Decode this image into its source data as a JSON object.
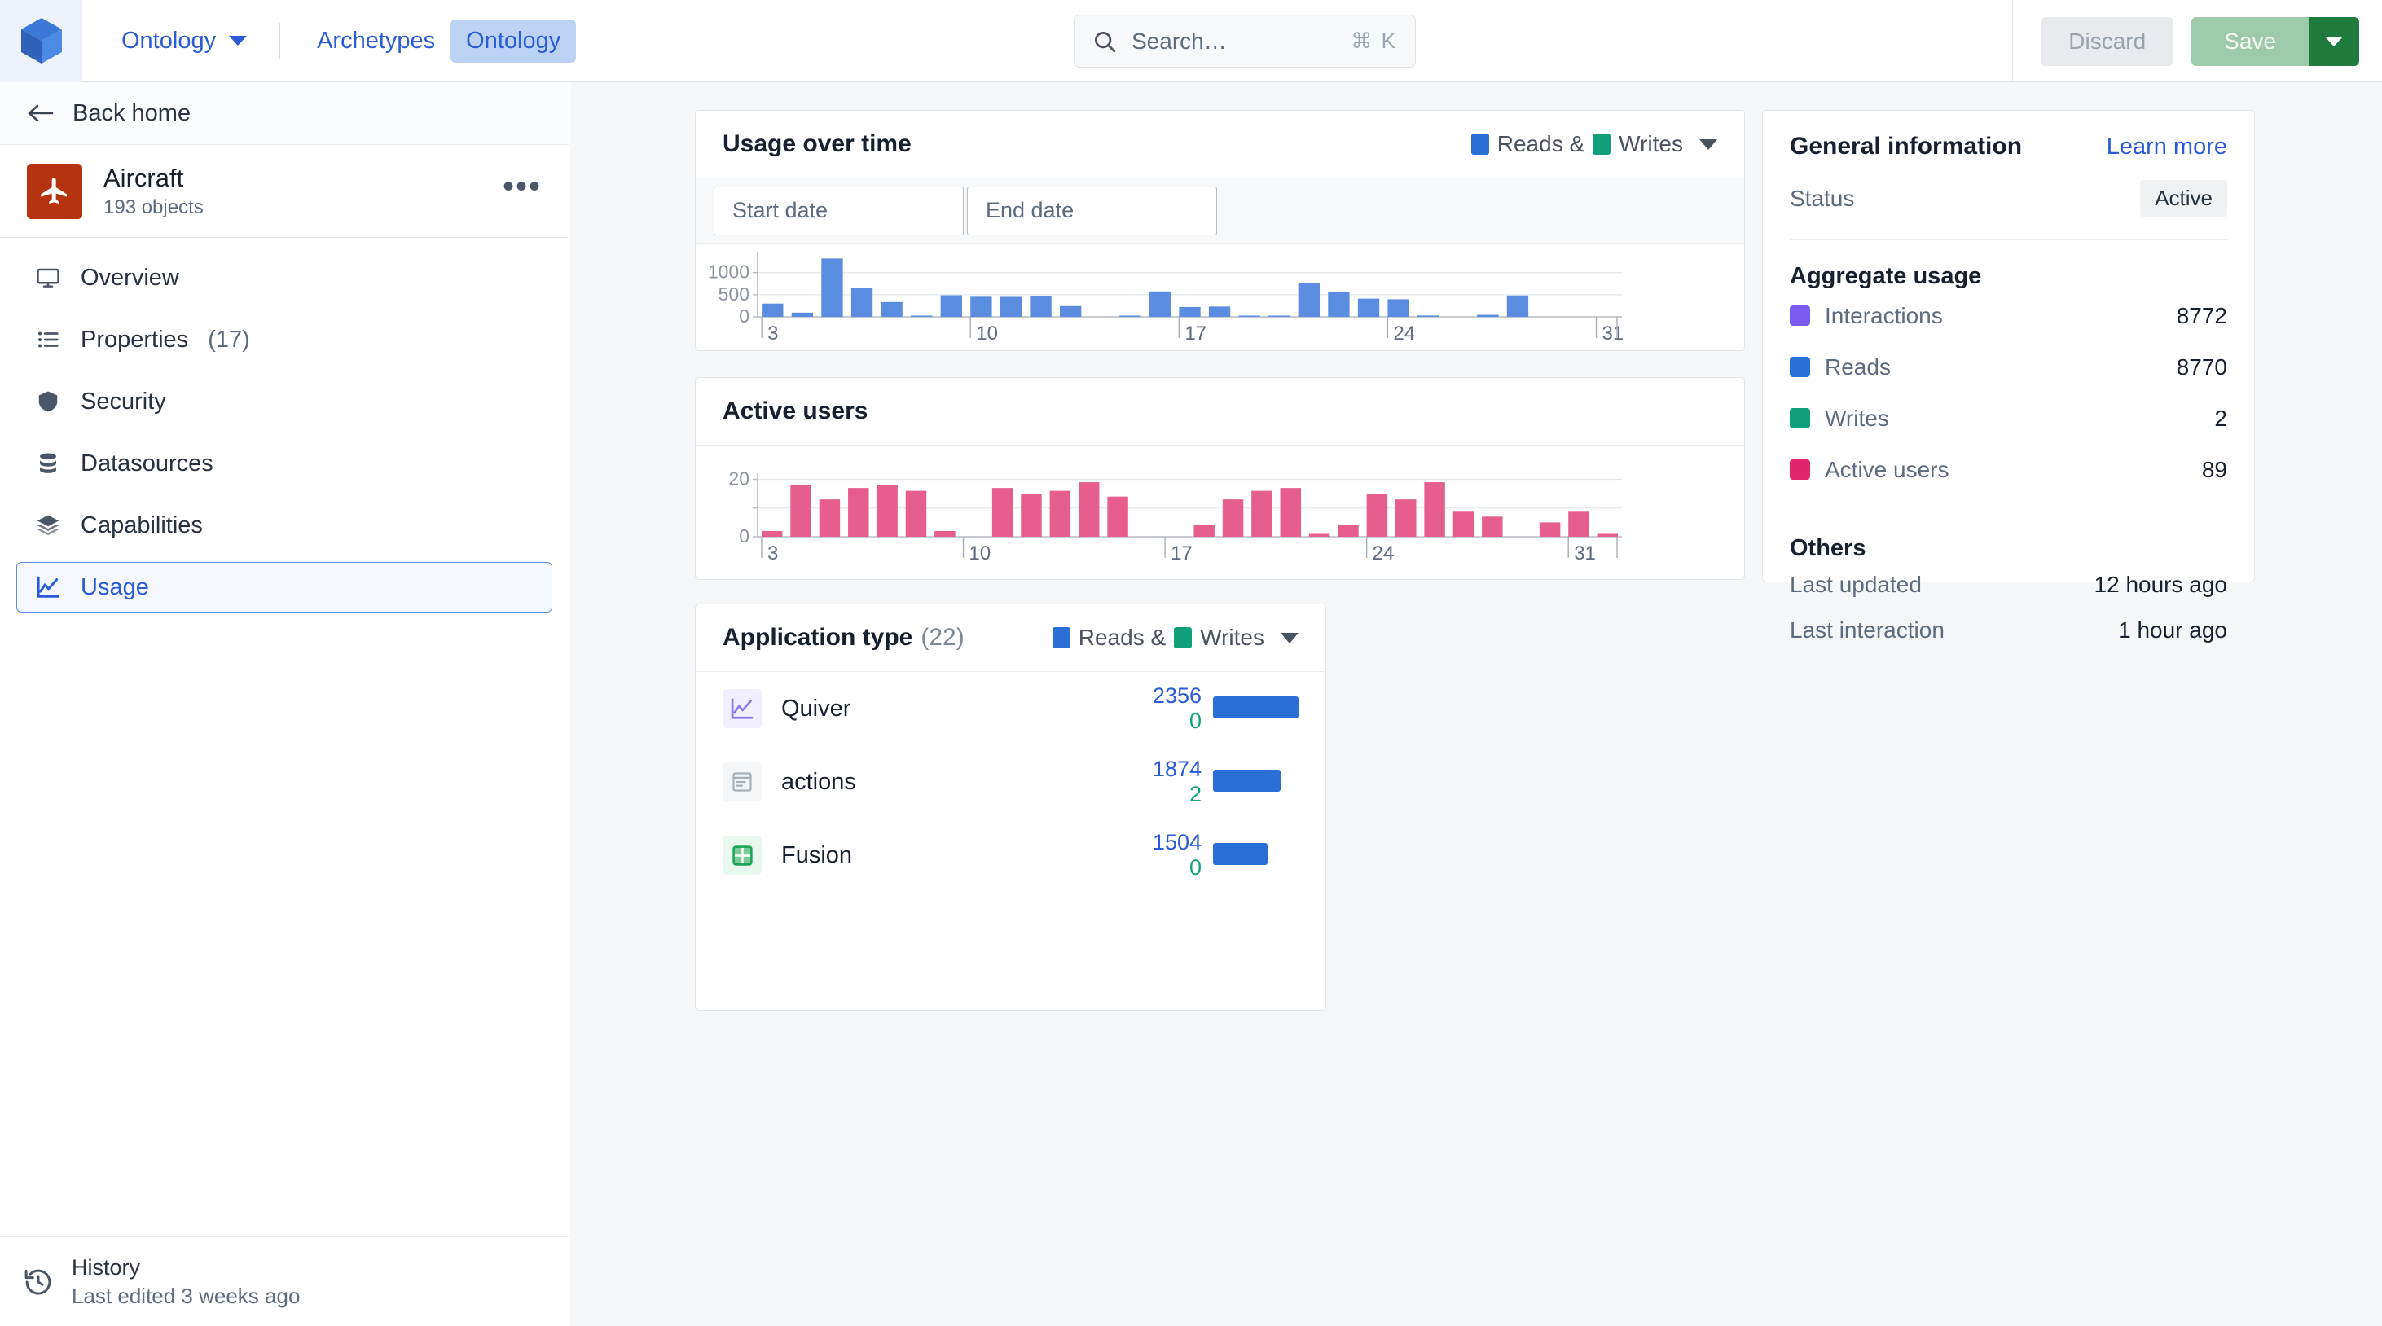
{
  "topbar": {
    "logo_icon": "cube-logo-icon",
    "ontology_dropdown": "Ontology",
    "tabs": [
      {
        "label": "Archetypes",
        "active": false
      },
      {
        "label": "Ontology",
        "active": true
      }
    ],
    "search": {
      "placeholder": "Search…",
      "shortcut": "⌘ K",
      "icon": "search-icon"
    },
    "discard_label": "Discard",
    "save_label": "Save",
    "save_caret_icon": "chevron-down-icon"
  },
  "sidebar": {
    "back_home": "Back home",
    "back_icon": "arrow-left-icon",
    "object": {
      "name": "Aircraft",
      "subtitle": "193 objects",
      "icon": "airplane-icon",
      "icon_bg": "#b5330f",
      "more_icon": "ellipsis-icon"
    },
    "items": [
      {
        "label": "Overview",
        "icon": "monitor-icon",
        "count": "",
        "active": false
      },
      {
        "label": "Properties",
        "icon": "list-icon",
        "count": "(17)",
        "active": false
      },
      {
        "label": "Security",
        "icon": "shield-icon",
        "count": "",
        "active": false
      },
      {
        "label": "Datasources",
        "icon": "database-icon",
        "count": "",
        "active": false
      },
      {
        "label": "Capabilities",
        "icon": "layers-icon",
        "count": "",
        "active": false
      },
      {
        "label": "Usage",
        "icon": "chart-line-icon",
        "count": "",
        "active": true
      }
    ],
    "history": {
      "title": "History",
      "subtitle": "Last edited 3 weeks ago",
      "icon": "history-clock-icon"
    }
  },
  "usage_card": {
    "title": "Usage over time",
    "legend": {
      "reads_label": "Reads &",
      "writes_label": "Writes",
      "reads_color": "#2a6fd6",
      "writes_color": "#0fa07a",
      "chevron_icon": "chevron-down-icon"
    },
    "start_date_placeholder": "Start date",
    "end_date_placeholder": "End date"
  },
  "active_users_card": {
    "title": "Active users"
  },
  "app_type_card": {
    "title": "Application type",
    "count": "(22)",
    "legend": {
      "reads_label": "Reads &",
      "writes_label": "Writes",
      "reads_color": "#2a6fd6",
      "writes_color": "#0fa07a",
      "chevron_icon": "chevron-down-icon"
    },
    "rows": [
      {
        "name": "Quiver",
        "icon": "chart-line-icon",
        "icon_bg": "#f1eefd",
        "icon_color": "#8b7ae8",
        "reads": "2356",
        "writes": "0",
        "bar_pct": 100
      },
      {
        "name": "actions",
        "icon": "window-icon",
        "icon_bg": "#f5f6f8",
        "icon_color": "#a8b0bb",
        "reads": "1874",
        "writes": "2",
        "bar_pct": 79
      },
      {
        "name": "Fusion",
        "icon": "grid-table-icon",
        "icon_bg": "#e9f8ee",
        "icon_color": "#1da356",
        "reads": "1504",
        "writes": "0",
        "bar_pct": 64
      }
    ]
  },
  "info_panel": {
    "title": "General information",
    "learn_more": "Learn more",
    "status_label": "Status",
    "status_value": "Active",
    "aggregate_title": "Aggregate usage",
    "aggregate": [
      {
        "label": "Interactions",
        "value": "8772",
        "color": "#7a5af0"
      },
      {
        "label": "Reads",
        "value": "8770",
        "color": "#2a6fd6"
      },
      {
        "label": "Writes",
        "value": "2",
        "color": "#0fa07a"
      },
      {
        "label": "Active users",
        "value": "89",
        "color": "#e0256d"
      }
    ],
    "others_title": "Others",
    "others": [
      {
        "label": "Last updated",
        "value": "12 hours ago"
      },
      {
        "label": "Last interaction",
        "value": "1 hour ago"
      }
    ]
  },
  "chart_data": [
    {
      "id": "usage-over-time",
      "type": "bar",
      "title": "Usage over time",
      "xlabel": "",
      "ylabel": "",
      "ylim": [
        0,
        1400
      ],
      "yticks": [
        0,
        500,
        1000
      ],
      "ytick_labels": [
        "0",
        "500",
        "1000"
      ],
      "xticks": [
        3,
        10,
        17,
        24,
        31
      ],
      "xtick_labels": [
        "3",
        "10",
        "17",
        "24",
        "31"
      ],
      "grid": true,
      "series_name": "Reads",
      "color": "#5a8ddf",
      "x": [
        3,
        4,
        5,
        6,
        7,
        8,
        9,
        10,
        11,
        12,
        13,
        14,
        15,
        16,
        17,
        18,
        19,
        20,
        21,
        22,
        23,
        24,
        25,
        26,
        27,
        28,
        29,
        30,
        31
      ],
      "values": [
        300,
        95,
        1320,
        650,
        335,
        12,
        487,
        455,
        452,
        468,
        243,
        0,
        15,
        575,
        222,
        233,
        8,
        14,
        765,
        572,
        412,
        398,
        30,
        0,
        45,
        483,
        0,
        0,
        0
      ]
    },
    {
      "id": "active-users",
      "type": "bar",
      "title": "Active users",
      "xlabel": "",
      "ylabel": "",
      "ylim": [
        0,
        21
      ],
      "yticks": [
        0,
        10,
        20
      ],
      "ytick_labels": [
        "0",
        "",
        "20"
      ],
      "xticks": [
        3,
        10,
        17,
        24,
        31
      ],
      "xtick_labels": [
        "3",
        "10",
        "17",
        "24",
        "31"
      ],
      "grid": true,
      "series_name": "Active users",
      "color": "#e55e8e",
      "x": [
        3,
        4,
        5,
        6,
        7,
        8,
        9,
        10,
        11,
        12,
        13,
        14,
        15,
        16,
        17,
        18,
        19,
        20,
        21,
        22,
        23,
        24,
        25,
        26,
        27,
        28,
        29,
        30,
        31
      ],
      "values": [
        2,
        18,
        13,
        17,
        18,
        16,
        2,
        0,
        17,
        15,
        16,
        19,
        14,
        0,
        0,
        4,
        13,
        16,
        17,
        1,
        4,
        15,
        13,
        19,
        9,
        7,
        0,
        5,
        9,
        1
      ]
    },
    {
      "id": "application-type",
      "type": "bar",
      "title": "Application type",
      "orientation": "horizontal",
      "categories": [
        "Quiver",
        "actions",
        "Fusion"
      ],
      "series": [
        {
          "name": "Reads",
          "values": [
            2356,
            1874,
            1504
          ],
          "color": "#2a6fd6"
        },
        {
          "name": "Writes",
          "values": [
            0,
            2,
            0
          ],
          "color": "#0fa07a"
        }
      ]
    }
  ]
}
